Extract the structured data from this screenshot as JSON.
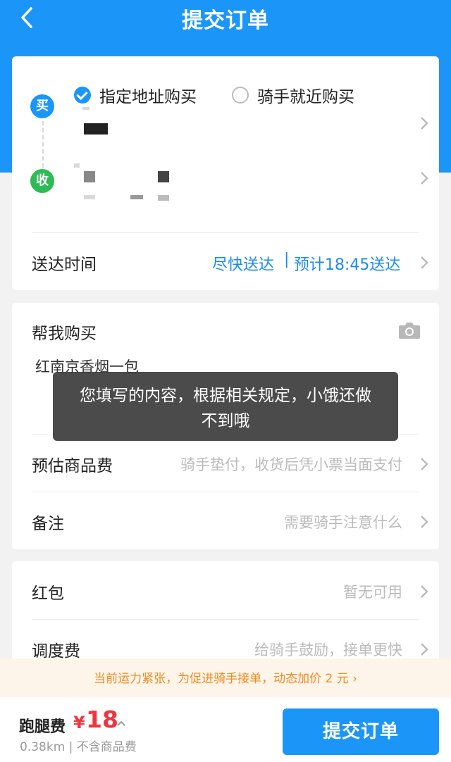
{
  "header": {
    "title": "提交订单",
    "back_icon": "chevron-left-icon"
  },
  "buy_mode": {
    "option_selected": "指定地址购买",
    "option_other": "骑手就近购买"
  },
  "addresses": {
    "buy_badge": "买",
    "receive_badge": "收"
  },
  "delivery": {
    "label": "送达时间",
    "mode": "尽快送达",
    "separator": "|",
    "estimate": "预计18:45送达"
  },
  "purchase": {
    "title": "帮我购买",
    "content": "红南京香烟一包",
    "camera_icon": "camera-icon"
  },
  "toast": {
    "message": "您填写的内容，根据相关规定，小饿还做不到哦"
  },
  "goods_fee": {
    "label": "预估商品费",
    "hint": "骑手垫付，收货后凭小票当面支付"
  },
  "remark": {
    "label": "备注",
    "hint": "需要骑手注意什么"
  },
  "red_packet": {
    "label": "红包",
    "hint": "暂无可用"
  },
  "dispatch_fee": {
    "label": "调度费",
    "hint": "给骑手鼓励，接单更快"
  },
  "notice": {
    "text": "当前运力紧张，为促进骑手接单，动态加价 2 元 ›"
  },
  "footer": {
    "fee_label": "跑腿费",
    "currency": "¥",
    "fee_value": "18",
    "distance_note": "0.38km | 不含商品费",
    "submit_label": "提交订单"
  },
  "colors": {
    "primary": "#1b96f8",
    "green": "#2dbb55",
    "price": "#f0353f",
    "notice": "#f08c20"
  }
}
